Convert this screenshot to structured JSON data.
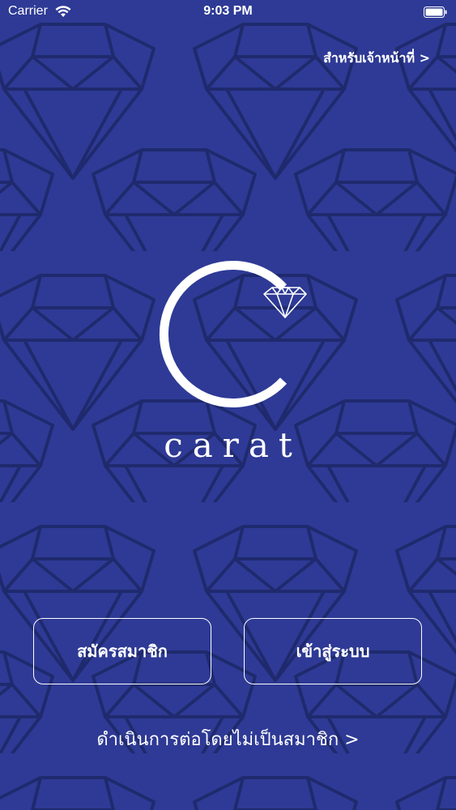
{
  "status_bar": {
    "carrier": "Carrier",
    "time": "9:03 PM"
  },
  "header": {
    "officer_link": "สำหรับเจ้าหน้าที่ >"
  },
  "logo": {
    "brand_name": "carat",
    "icon": "diamond-c-logo-icon"
  },
  "actions": {
    "register_label": "สมัครสมาชิก",
    "login_label": "เข้าสู่ระบบ",
    "guest_label": "ดำเนินการต่อโดยไม่เป็นสมาชิก >"
  },
  "colors": {
    "background": "#2e3a95",
    "pattern_stroke": "#1f2a6e",
    "foreground": "#ffffff"
  }
}
